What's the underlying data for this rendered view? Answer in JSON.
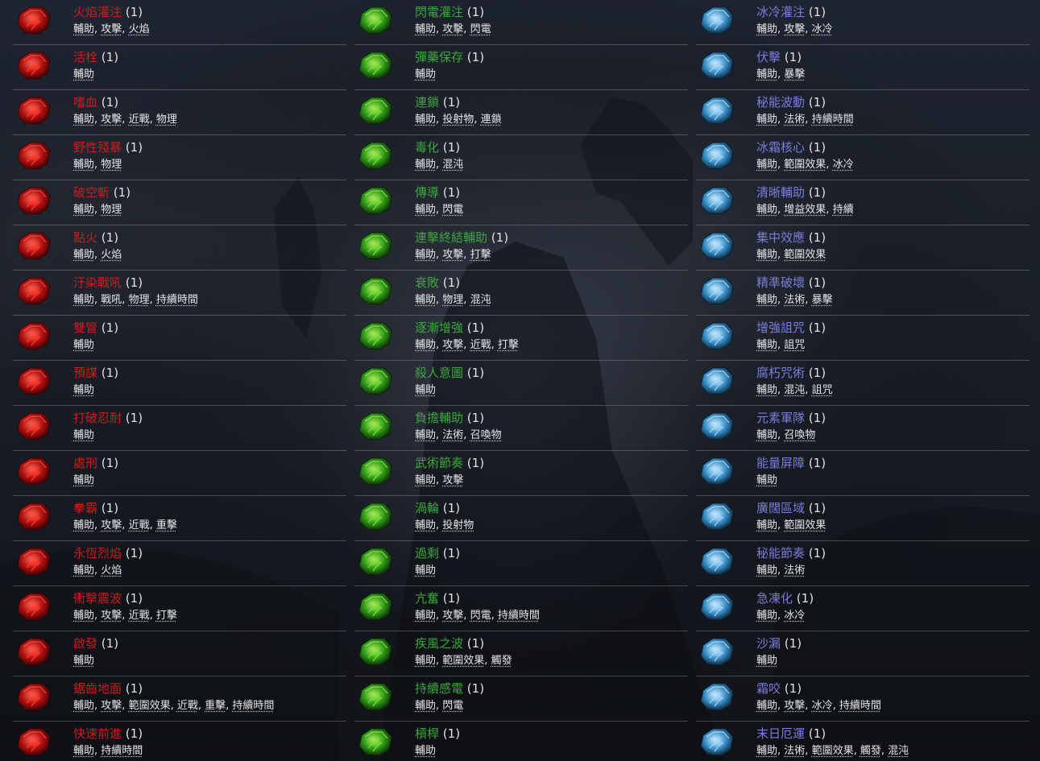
{
  "colors": {
    "red": "#c42020",
    "green": "#3da63d",
    "blue": "#7c7cdc",
    "tag": "#e6e6e6",
    "divider": "#8c8c8c"
  },
  "columns": [
    {
      "color": "red",
      "gem_icon": "red-strength-gem-icon",
      "items": [
        {
          "name": "火焰灌注",
          "count": "(1)",
          "tags": [
            "輔助",
            "攻擊",
            "火焰"
          ]
        },
        {
          "name": "活栓",
          "count": "(1)",
          "tags": [
            "輔助"
          ]
        },
        {
          "name": "嗜血",
          "count": "(1)",
          "tags": [
            "輔助",
            "攻擊",
            "近戰",
            "物理"
          ]
        },
        {
          "name": "野性殘暴",
          "count": "(1)",
          "tags": [
            "輔助",
            "物理"
          ]
        },
        {
          "name": "破空斬",
          "count": "(1)",
          "tags": [
            "輔助",
            "物理"
          ]
        },
        {
          "name": "點火",
          "count": "(1)",
          "tags": [
            "輔助",
            "火焰"
          ]
        },
        {
          "name": "汙染戰吼",
          "count": "(1)",
          "tags": [
            "輔助",
            "戰吼",
            "物理",
            "持續時間"
          ]
        },
        {
          "name": "雙管",
          "count": "(1)",
          "tags": [
            "輔助"
          ]
        },
        {
          "name": "預謀",
          "count": "(1)",
          "tags": [
            "輔助"
          ]
        },
        {
          "name": "打破忍耐",
          "count": "(1)",
          "tags": [
            "輔助"
          ]
        },
        {
          "name": "處刑",
          "count": "(1)",
          "tags": [
            "輔助"
          ]
        },
        {
          "name": "拳霸",
          "count": "(1)",
          "tags": [
            "輔助",
            "攻擊",
            "近戰",
            "重擊"
          ]
        },
        {
          "name": "永恆烈焰",
          "count": "(1)",
          "tags": [
            "輔助",
            "火焰"
          ]
        },
        {
          "name": "衝擊震波",
          "count": "(1)",
          "tags": [
            "輔助",
            "攻擊",
            "近戰",
            "打擊"
          ]
        },
        {
          "name": "啟發",
          "count": "(1)",
          "tags": [
            "輔助"
          ]
        },
        {
          "name": "鋸齒地面",
          "count": "(1)",
          "tags": [
            "輔助",
            "攻擊",
            "範圍效果",
            "近戰",
            "重擊",
            "持續時間"
          ]
        },
        {
          "name": "快速前進",
          "count": "(1)",
          "tags": [
            "輔助",
            "持續時間"
          ]
        }
      ]
    },
    {
      "color": "green",
      "gem_icon": "green-dexterity-gem-icon",
      "items": [
        {
          "name": "閃電灌注",
          "count": "(1)",
          "tags": [
            "輔助",
            "攻擊",
            "閃電"
          ]
        },
        {
          "name": "彈藥保存",
          "count": "(1)",
          "tags": [
            "輔助"
          ]
        },
        {
          "name": "連鎖",
          "count": "(1)",
          "tags": [
            "輔助",
            "投射物",
            "連鎖"
          ]
        },
        {
          "name": "毒化",
          "count": "(1)",
          "tags": [
            "輔助",
            "混沌"
          ]
        },
        {
          "name": "傳導",
          "count": "(1)",
          "tags": [
            "輔助",
            "閃電"
          ]
        },
        {
          "name": "連擊終結輔助",
          "count": "(1)",
          "tags": [
            "輔助",
            "攻擊",
            "打擊"
          ]
        },
        {
          "name": "衰敗",
          "count": "(1)",
          "tags": [
            "輔助",
            "物理",
            "混沌"
          ]
        },
        {
          "name": "逐漸增強",
          "count": "(1)",
          "tags": [
            "輔助",
            "攻擊",
            "近戰",
            "打擊"
          ]
        },
        {
          "name": "殺人意圖",
          "count": "(1)",
          "tags": [
            "輔助"
          ]
        },
        {
          "name": "負擔輔助",
          "count": "(1)",
          "tags": [
            "輔助",
            "法術",
            "召喚物"
          ]
        },
        {
          "name": "武術節奏",
          "count": "(1)",
          "tags": [
            "輔助",
            "攻擊"
          ]
        },
        {
          "name": "渦輪",
          "count": "(1)",
          "tags": [
            "輔助",
            "投射物"
          ]
        },
        {
          "name": "過剩",
          "count": "(1)",
          "tags": [
            "輔助"
          ]
        },
        {
          "name": "亢奮",
          "count": "(1)",
          "tags": [
            "輔助",
            "攻擊",
            "閃電",
            "持續時間"
          ]
        },
        {
          "name": "疾風之波",
          "count": "(1)",
          "tags": [
            "輔助",
            "範圍效果",
            "觸發"
          ]
        },
        {
          "name": "持續感電",
          "count": "(1)",
          "tags": [
            "輔助",
            "閃電"
          ]
        },
        {
          "name": "槓桿",
          "count": "(1)",
          "tags": [
            "輔助"
          ]
        }
      ]
    },
    {
      "color": "blue",
      "gem_icon": "blue-intelligence-gem-icon",
      "items": [
        {
          "name": "冰冷灌注",
          "count": "(1)",
          "tags": [
            "輔助",
            "攻擊",
            "冰冷"
          ]
        },
        {
          "name": "伏擊",
          "count": "(1)",
          "tags": [
            "輔助",
            "暴擊"
          ]
        },
        {
          "name": "秘能波動",
          "count": "(1)",
          "tags": [
            "輔助",
            "法術",
            "持續時間"
          ]
        },
        {
          "name": "冰霜核心",
          "count": "(1)",
          "tags": [
            "輔助",
            "範圍效果",
            "冰冷"
          ]
        },
        {
          "name": "清晰輔助",
          "count": "(1)",
          "tags": [
            "輔助",
            "增益效果",
            "持續"
          ]
        },
        {
          "name": "集中效應",
          "count": "(1)",
          "tags": [
            "輔助",
            "範圍效果"
          ]
        },
        {
          "name": "精準破壞",
          "count": "(1)",
          "tags": [
            "輔助",
            "法術",
            "暴擊"
          ]
        },
        {
          "name": "增強詛咒",
          "count": "(1)",
          "tags": [
            "輔助",
            "詛咒"
          ]
        },
        {
          "name": "腐朽咒術",
          "count": "(1)",
          "tags": [
            "輔助",
            "混沌",
            "詛咒"
          ]
        },
        {
          "name": "元素軍隊",
          "count": "(1)",
          "tags": [
            "輔助",
            "召喚物"
          ]
        },
        {
          "name": "能量屏障",
          "count": "(1)",
          "tags": [
            "輔助"
          ]
        },
        {
          "name": "廣闊區域",
          "count": "(1)",
          "tags": [
            "輔助",
            "範圍效果"
          ]
        },
        {
          "name": "秘能節奏",
          "count": "(1)",
          "tags": [
            "輔助",
            "法術"
          ]
        },
        {
          "name": "急凍化",
          "count": "(1)",
          "tags": [
            "輔助",
            "冰冷"
          ]
        },
        {
          "name": "沙漏",
          "count": "(1)",
          "tags": [
            "輔助"
          ]
        },
        {
          "name": "霜咬",
          "count": "(1)",
          "tags": [
            "輔助",
            "攻擊",
            "冰冷",
            "持續時間"
          ]
        },
        {
          "name": "末日厄運",
          "count": "(1)",
          "tags": [
            "輔助",
            "法術",
            "範圍效果",
            "觸發",
            "混沌"
          ]
        }
      ]
    }
  ]
}
